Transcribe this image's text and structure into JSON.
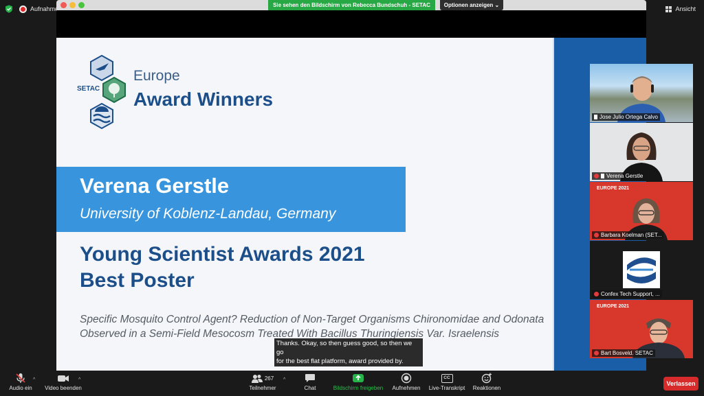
{
  "topbar": {
    "recording_label": "Aufnahme",
    "view_label": "Ansicht",
    "share_banner": "Sie sehen den Bildschirm von Rebecca Bundschuh - SETAC",
    "options_label": "Optionen anzeigen"
  },
  "slide": {
    "logo_text": "SETAC",
    "europe": "Europe",
    "award_winners": "Award Winners",
    "winner_name": "Verena Gerstle",
    "university": "University of Koblenz-Landau, Germany",
    "award_line1": "Young Scientist Awards 2021",
    "award_line2": "Best Poster",
    "poster_title": "Specific Mosquito Control Agent? Reduction of Non-Target Organisms Chironomidae and Odonata Observed in a Semi-Field Mesocosm Treated With Bacillus Thuringiensis Var. Israelensis"
  },
  "caption": {
    "line1": "Thanks. Okay, so then guess good, so then we go",
    "line2": "for the best flat platform, award provided by."
  },
  "participants": [
    {
      "name": "Jose Julio Ortega Calvo"
    },
    {
      "name": "Verena Gerstle"
    },
    {
      "name": "Barbara Koelman (SET...",
      "background_text": "EUROPE 2021"
    },
    {
      "name": "Confex Tech Support, ..."
    },
    {
      "name": "Bart Bosveld. SETAC",
      "background_text": "EUROPE 2021"
    }
  ],
  "toolbar": {
    "audio": "Audio ein",
    "video": "Video beenden",
    "participants": "Teilnehmer",
    "participant_count": "267",
    "chat": "Chat",
    "share": "Bildschirm freigeben",
    "record": "Aufnehmen",
    "transcript": "Live-Transkript",
    "reactions": "Reaktionen",
    "cc_icon_text": "CC",
    "leave": "Verlassen"
  },
  "colors": {
    "share_green": "#28a845",
    "slide_blue": "#1b5ea8",
    "name_band": "#3895dd",
    "leave_red": "#d72b2b",
    "setac_red": "#d8372c"
  }
}
